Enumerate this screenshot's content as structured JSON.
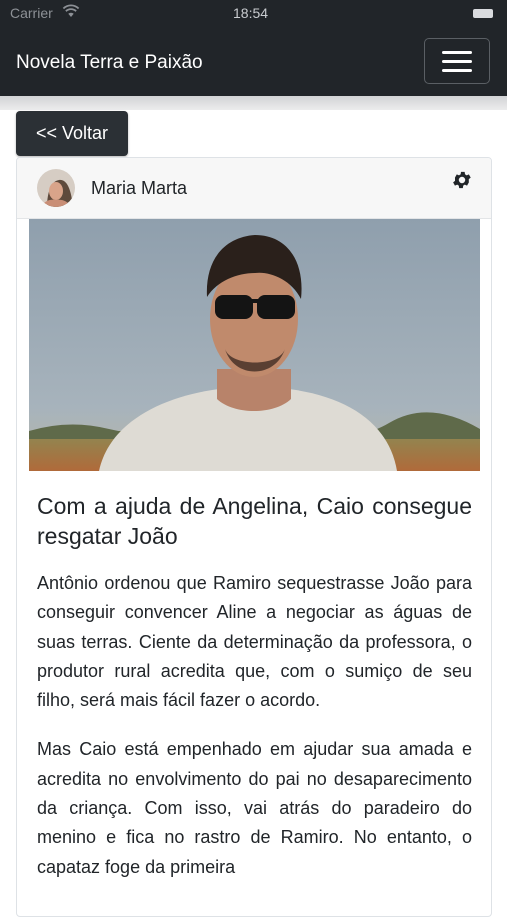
{
  "status_bar": {
    "carrier": "Carrier",
    "time": "18:54"
  },
  "navbar": {
    "brand": "Novela Terra e Paixão",
    "toggler_icon": "hamburger-menu-icon"
  },
  "back_button": {
    "label": "<< Voltar"
  },
  "post": {
    "author": "Maria Marta",
    "settings_icon": "gear-icon",
    "title": "Com a ajuda de Angelina, Caio consegue resgatar João",
    "paragraphs": [
      "Antônio ordenou que Ramiro  sequestrasse João para conseguir convencer Aline  a negociar as águas de suas terras. Ciente da determinação da professora, o produtor rural acredita que, com o sumiço de seu filho, será mais fácil fazer o acordo.",
      "Mas Caio  está empenhado em ajudar sua amada e acredita no envolvimento do pai no desaparecimento da criança. Com isso, vai atrás do paradeiro do menino e fica no rastro de Ramiro. No entanto, o capataz foge da primeira"
    ]
  },
  "colors": {
    "navbar": "#212529",
    "back_button": "#2b3035",
    "card_header": "#f7f7f7"
  }
}
